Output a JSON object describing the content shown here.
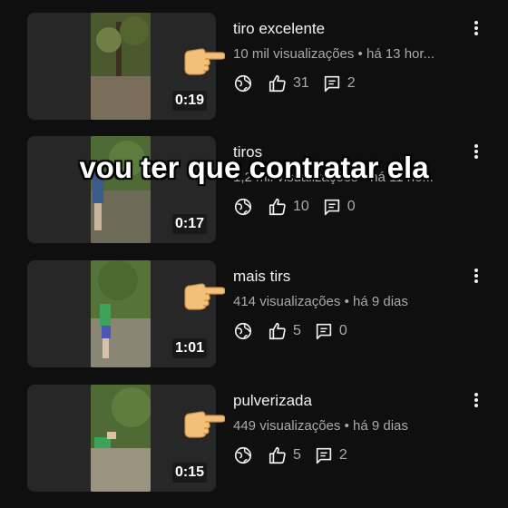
{
  "caption": "vou ter que contratar ela",
  "videos": [
    {
      "title": "tiro excelente",
      "views": "10 mil visualizações",
      "age": "há 13 hor...",
      "likes": "31",
      "comments": "2",
      "duration": "0:19"
    },
    {
      "title": "tiros",
      "views": "1,2 mil visualizações",
      "age": "há 11 ho...",
      "likes": "10",
      "comments": "0",
      "duration": "0:17"
    },
    {
      "title": "mais tirs",
      "views": "414 visualizações",
      "age": "há 9 dias",
      "likes": "5",
      "comments": "0",
      "duration": "1:01"
    },
    {
      "title": "pulverizada",
      "views": "449 visualizações",
      "age": "há 9 dias",
      "likes": "5",
      "comments": "2",
      "duration": "0:15"
    }
  ],
  "separator": " • ",
  "icons": {
    "visibility": "globe-icon",
    "likes": "thumbs-up-icon",
    "comments": "comment-icon",
    "menu": "more-vert-icon",
    "pointer": "pointing-hand-icon"
  },
  "colors": {
    "background": "#0f0f0f",
    "text": "#f1f1f1",
    "secondary": "#aaaaaa"
  }
}
